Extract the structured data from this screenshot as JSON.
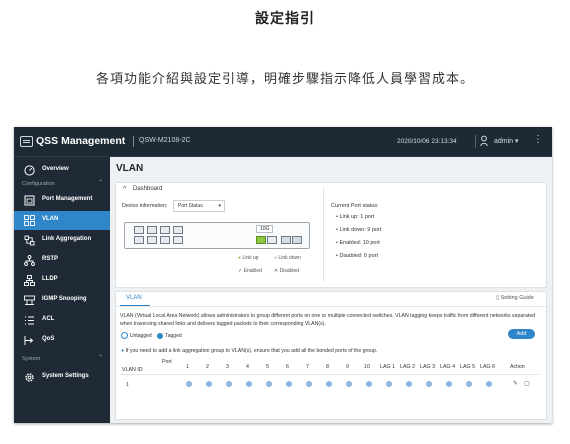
{
  "promo": {
    "title": "設定指引",
    "subtitle": "各項功能介紹與設定引導，明確步驟指示降低人員學習成本。"
  },
  "app": {
    "title": "QSS Management",
    "model": "QSW-M2108-2C",
    "datetime": "2020/10/06  23:13:34",
    "user": "admin ▾"
  },
  "sidebar": {
    "overview": "Overview",
    "group_configuration": "Configuration",
    "group_system": "System",
    "items": [
      {
        "label": "Port Management",
        "icon": "port-icon"
      },
      {
        "label": "VLAN",
        "icon": "vlan-icon"
      },
      {
        "label": "Link Aggregation",
        "icon": "link-aggregation-icon"
      },
      {
        "label": "RSTP",
        "icon": "rstp-icon"
      },
      {
        "label": "LLDP",
        "icon": "lldp-icon"
      },
      {
        "label": "IGMP Snooping",
        "icon": "igmp-icon"
      },
      {
        "label": "ACL",
        "icon": "acl-icon"
      },
      {
        "label": "QoS",
        "icon": "qos-icon"
      }
    ],
    "system_items": [
      {
        "label": "System Settings",
        "icon": "gear-icon"
      }
    ],
    "collapse": "«"
  },
  "main": {
    "page_title": "VLAN",
    "dashboard": {
      "label": "Dashboard",
      "device_info_label": "Device information:",
      "device_info_value": "Port Status",
      "tengig_label": "10G",
      "legend_link_up": "Link up",
      "legend_link_down": "Link down",
      "legend_enabled": "Enabled",
      "legend_disabled": "Disabled",
      "status_title": "Current Port status:",
      "status": [
        "Link up:  1 port",
        "Link down:  9 port",
        "Enabled:  10 port",
        "Disabled:  0 port"
      ]
    },
    "vlan": {
      "tab_label": "VLAN",
      "setting_guide": "Setting Guide",
      "description": "VLAN (Virtual Local Area Network) allows administrators to group different ports on one or multiple connected switches. VLAN tagging keeps traffic from different networks separated when traversing shared links and delivers tagged packets to their corresponding VLAN(s).",
      "untagged": "Untagged",
      "tagged": "Tagged",
      "add_button": "Add",
      "note": "If you need to add a link aggregation group to VLAN(s), ensure that you add all the bonded ports of the group.",
      "table": {
        "vlan_id_header": "VLAN ID",
        "port_header": "Port",
        "columns": [
          "1",
          "2",
          "3",
          "4",
          "5",
          "6",
          "7",
          "8",
          "9",
          "10",
          "LAG 1",
          "LAG 2",
          "LAG 3",
          "LAG 4",
          "LAG 5",
          "LAG 6"
        ],
        "action_header": "Action",
        "rows": [
          {
            "vlan_id": "1"
          }
        ]
      }
    }
  },
  "colors": {
    "accent": "#2f86c9",
    "sidebar_bg": "#1f2a36",
    "link_up": "#8fc63f"
  }
}
